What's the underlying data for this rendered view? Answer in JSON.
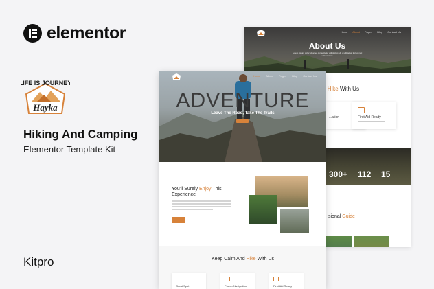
{
  "brand": {
    "elementor_word": "elementor",
    "kit_title": "Hiking And Camping",
    "kit_subtitle": "Elementor Template Kit",
    "author": "Kitpro",
    "hayka_top_text": "LIFE IS JOURNEY",
    "hayka_name": "Hayka"
  },
  "colors": {
    "accent": "#d7823a",
    "dark": "#111111"
  },
  "back_page": {
    "nav": [
      "Home",
      "About",
      "Pages",
      "Blog",
      "Contact Us"
    ],
    "hero_title": "About Us",
    "hero_text": "Lorem ipsum dolor sit amet consectetur adipiscing elit ut elit tellus luctus nec ullamcorper",
    "section_title_suffix": "d",
    "section_title_accent": "Hike",
    "section_title_rest": "With Us",
    "features": [
      "...ation",
      "First Aid Ready"
    ],
    "stats": [
      "300+",
      "112",
      "15"
    ],
    "guide_prefix": "sional",
    "guide_accent": "Guide"
  },
  "front_page": {
    "nav": [
      "Home",
      "About",
      "Pages",
      "Blog",
      "Contact Us"
    ],
    "hero_title": "ADVENTURE",
    "hero_subtitle": "Leave The Road, Take The Trails",
    "enjoy_prefix": "You'll Surely",
    "enjoy_accent": "Enjoy",
    "enjoy_rest": "This",
    "enjoy_line2": "Experience",
    "calm_prefix": "Keep Calm And",
    "calm_accent": "Hike",
    "calm_rest": "With Us",
    "mini_features": [
      "Great Spot",
      "Proper Navigation",
      "First Aid Ready"
    ]
  }
}
